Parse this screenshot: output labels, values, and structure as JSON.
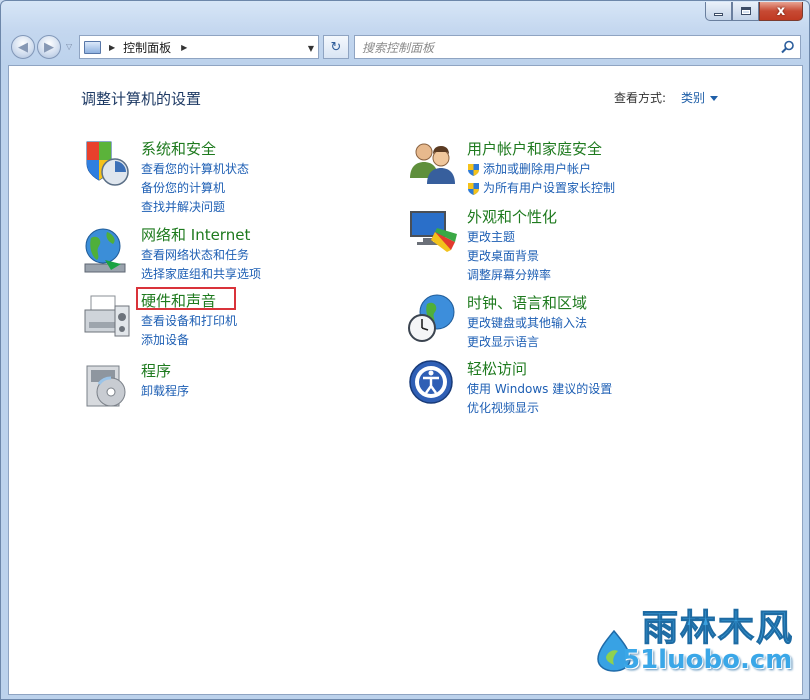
{
  "window": {
    "caption_buttons": {
      "minimize": "–",
      "maximize": "□",
      "close": "x"
    }
  },
  "nav": {
    "back": "◀",
    "forward": "▶",
    "breadcrumb": "控制面板",
    "search_placeholder": "搜索控制面板",
    "refresh": "↻"
  },
  "content": {
    "heading": "调整计算机的设置",
    "view_by_label": "查看方式:",
    "view_by_value": "类别"
  },
  "categories_left": [
    {
      "title": "系统和安全",
      "icon": "system-security-icon",
      "links": [
        "查看您的计算机状态",
        "备份您的计算机",
        "查找并解决问题"
      ]
    },
    {
      "title": "网络和 Internet",
      "icon": "network-globe-icon",
      "links": [
        "查看网络状态和任务",
        "选择家庭组和共享选项"
      ]
    },
    {
      "title": "硬件和声音",
      "icon": "printer-hardware-icon",
      "links": [
        "查看设备和打印机",
        "添加设备"
      ]
    },
    {
      "title": "程序",
      "icon": "programs-disc-icon",
      "links": [
        "卸载程序"
      ]
    }
  ],
  "categories_right": [
    {
      "title": "用户帐户和家庭安全",
      "icon": "users-icon",
      "links": [
        "添加或删除用户帐户",
        "为所有用户设置家长控制"
      ]
    },
    {
      "title": "外观和个性化",
      "icon": "appearance-monitor-icon",
      "links": [
        "更改主题",
        "更改桌面背景",
        "调整屏幕分辨率"
      ]
    },
    {
      "title": "时钟、语言和区域",
      "icon": "clock-globe-icon",
      "links": [
        "更改键盘或其他输入法",
        "更改显示语言"
      ]
    },
    {
      "title": "轻松访问",
      "icon": "ease-of-access-icon",
      "links": [
        "使用 Windows 建议的设置",
        "优化视频显示"
      ]
    }
  ],
  "watermark": {
    "chinese": "雨林木风",
    "url": "51luobo.cm"
  },
  "colors": {
    "category_title": "#1e7a1e",
    "link": "#1e5fb4",
    "heading": "#1f3b65",
    "highlight_box": "#d9333a"
  }
}
